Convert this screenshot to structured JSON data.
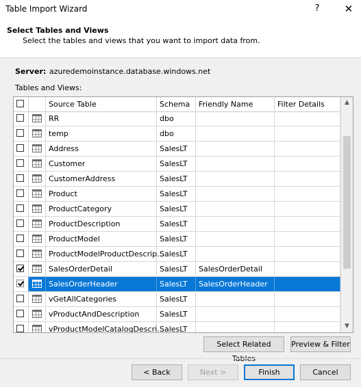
{
  "window": {
    "title": "Table Import Wizard",
    "help_glyph": "?",
    "close_glyph": "✕"
  },
  "header": {
    "title": "Select Tables and Views",
    "subtitle": "Select the tables and views that you want to import data from."
  },
  "server": {
    "label": "Server:",
    "value": "azuredemoinstance.database.windows.net"
  },
  "grid": {
    "label": "Tables and Views:",
    "columns": {
      "source": "Source Table",
      "schema": "Schema",
      "friendly": "Friendly Name",
      "filter": "Filter Details"
    },
    "rows": [
      {
        "source": "RR",
        "schema": "dbo",
        "friendly": "",
        "filter": "",
        "checked": false,
        "selected": false
      },
      {
        "source": "temp",
        "schema": "dbo",
        "friendly": "",
        "filter": "",
        "checked": false,
        "selected": false
      },
      {
        "source": "Address",
        "schema": "SalesLT",
        "friendly": "",
        "filter": "",
        "checked": false,
        "selected": false
      },
      {
        "source": "Customer",
        "schema": "SalesLT",
        "friendly": "",
        "filter": "",
        "checked": false,
        "selected": false
      },
      {
        "source": "CustomerAddress",
        "schema": "SalesLT",
        "friendly": "",
        "filter": "",
        "checked": false,
        "selected": false
      },
      {
        "source": "Product",
        "schema": "SalesLT",
        "friendly": "",
        "filter": "",
        "checked": false,
        "selected": false
      },
      {
        "source": "ProductCategory",
        "schema": "SalesLT",
        "friendly": "",
        "filter": "",
        "checked": false,
        "selected": false
      },
      {
        "source": "ProductDescription",
        "schema": "SalesLT",
        "friendly": "",
        "filter": "",
        "checked": false,
        "selected": false
      },
      {
        "source": "ProductModel",
        "schema": "SalesLT",
        "friendly": "",
        "filter": "",
        "checked": false,
        "selected": false
      },
      {
        "source": "ProductModelProductDescrip...",
        "schema": "SalesLT",
        "friendly": "",
        "filter": "",
        "checked": false,
        "selected": false
      },
      {
        "source": "SalesOrderDetail",
        "schema": "SalesLT",
        "friendly": "SalesOrderDetail",
        "filter": "",
        "checked": true,
        "selected": false
      },
      {
        "source": "SalesOrderHeader",
        "schema": "SalesLT",
        "friendly": "SalesOrderHeader",
        "filter": "",
        "checked": true,
        "selected": true
      },
      {
        "source": "vGetAllCategories",
        "schema": "SalesLT",
        "friendly": "",
        "filter": "",
        "checked": false,
        "selected": false
      },
      {
        "source": "vProductAndDescription",
        "schema": "SalesLT",
        "friendly": "",
        "filter": "",
        "checked": false,
        "selected": false
      },
      {
        "source": "vProductModelCatalogDescri...",
        "schema": "SalesLT",
        "friendly": "",
        "filter": "",
        "checked": false,
        "selected": false
      }
    ]
  },
  "buttons": {
    "select_related": "Select Related Tables",
    "preview_filter": "Preview & Filter",
    "back": "< Back",
    "next": "Next >",
    "finish": "Finish",
    "cancel": "Cancel"
  },
  "colors": {
    "selection": "#0a78d7",
    "default_button_border": "#0078d7"
  },
  "icons": {
    "row_icon": "table-icon",
    "scroll_up": "▲",
    "scroll_down": "▼"
  }
}
